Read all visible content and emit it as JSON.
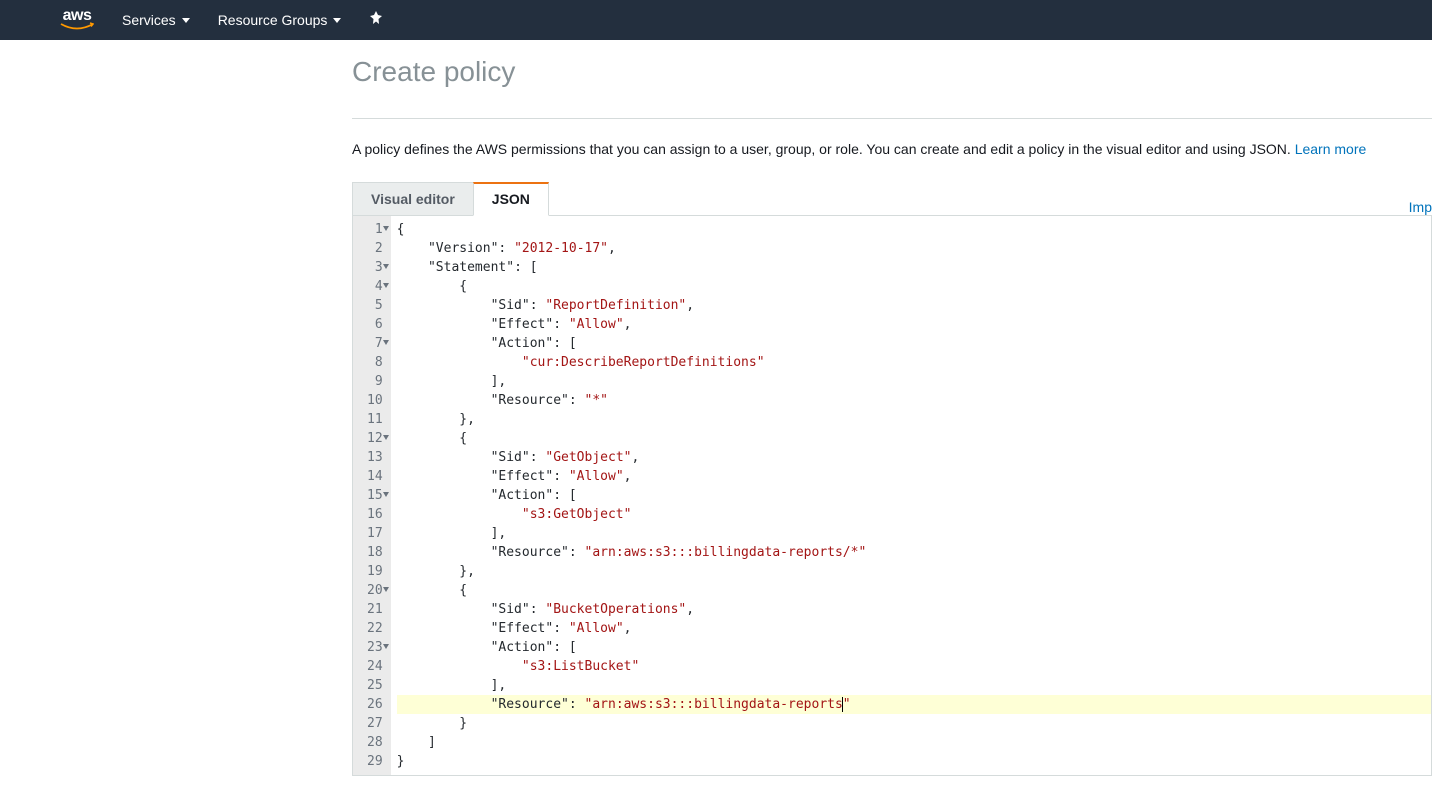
{
  "nav": {
    "logo_text": "aws",
    "services": "Services",
    "resource_groups": "Resource Groups"
  },
  "page": {
    "title": "Create policy",
    "description_prefix": "A policy defines the AWS permissions that you can assign to a user, group, or role. You can create and edit a policy in the visual editor and using JSON. ",
    "learn_more": "Learn more",
    "import_link": "Imp"
  },
  "tabs": {
    "visual": "Visual editor",
    "json": "JSON"
  },
  "editor": {
    "line_count": 29,
    "fold_lines": [
      1,
      3,
      4,
      7,
      12,
      15,
      20,
      23
    ],
    "highlighted_line": 26,
    "code_tokens": [
      [
        {
          "t": "{",
          "c": ""
        }
      ],
      [
        {
          "t": "    ",
          "c": ""
        },
        {
          "t": "\"Version\"",
          "c": "key"
        },
        {
          "t": ": ",
          "c": ""
        },
        {
          "t": "\"2012-10-17\"",
          "c": "str"
        },
        {
          "t": ",",
          "c": ""
        }
      ],
      [
        {
          "t": "    ",
          "c": ""
        },
        {
          "t": "\"Statement\"",
          "c": "key"
        },
        {
          "t": ": [",
          "c": ""
        }
      ],
      [
        {
          "t": "        {",
          "c": ""
        }
      ],
      [
        {
          "t": "            ",
          "c": ""
        },
        {
          "t": "\"Sid\"",
          "c": "key"
        },
        {
          "t": ": ",
          "c": ""
        },
        {
          "t": "\"ReportDefinition\"",
          "c": "str"
        },
        {
          "t": ",",
          "c": ""
        }
      ],
      [
        {
          "t": "            ",
          "c": ""
        },
        {
          "t": "\"Effect\"",
          "c": "key"
        },
        {
          "t": ": ",
          "c": ""
        },
        {
          "t": "\"Allow\"",
          "c": "str"
        },
        {
          "t": ",",
          "c": ""
        }
      ],
      [
        {
          "t": "            ",
          "c": ""
        },
        {
          "t": "\"Action\"",
          "c": "key"
        },
        {
          "t": ": [",
          "c": ""
        }
      ],
      [
        {
          "t": "                ",
          "c": ""
        },
        {
          "t": "\"cur:DescribeReportDefinitions\"",
          "c": "str"
        }
      ],
      [
        {
          "t": "            ],",
          "c": ""
        }
      ],
      [
        {
          "t": "            ",
          "c": ""
        },
        {
          "t": "\"Resource\"",
          "c": "key"
        },
        {
          "t": ": ",
          "c": ""
        },
        {
          "t": "\"*\"",
          "c": "str"
        }
      ],
      [
        {
          "t": "        },",
          "c": ""
        }
      ],
      [
        {
          "t": "        {",
          "c": ""
        }
      ],
      [
        {
          "t": "            ",
          "c": ""
        },
        {
          "t": "\"Sid\"",
          "c": "key"
        },
        {
          "t": ": ",
          "c": ""
        },
        {
          "t": "\"GetObject\"",
          "c": "str"
        },
        {
          "t": ",",
          "c": ""
        }
      ],
      [
        {
          "t": "            ",
          "c": ""
        },
        {
          "t": "\"Effect\"",
          "c": "key"
        },
        {
          "t": ": ",
          "c": ""
        },
        {
          "t": "\"Allow\"",
          "c": "str"
        },
        {
          "t": ",",
          "c": ""
        }
      ],
      [
        {
          "t": "            ",
          "c": ""
        },
        {
          "t": "\"Action\"",
          "c": "key"
        },
        {
          "t": ": [",
          "c": ""
        }
      ],
      [
        {
          "t": "                ",
          "c": ""
        },
        {
          "t": "\"s3:GetObject\"",
          "c": "str"
        }
      ],
      [
        {
          "t": "            ],",
          "c": ""
        }
      ],
      [
        {
          "t": "            ",
          "c": ""
        },
        {
          "t": "\"Resource\"",
          "c": "key"
        },
        {
          "t": ": ",
          "c": ""
        },
        {
          "t": "\"arn:aws:s3:::billingdata-reports/*\"",
          "c": "str"
        }
      ],
      [
        {
          "t": "        },",
          "c": ""
        }
      ],
      [
        {
          "t": "        {",
          "c": ""
        }
      ],
      [
        {
          "t": "            ",
          "c": ""
        },
        {
          "t": "\"Sid\"",
          "c": "key"
        },
        {
          "t": ": ",
          "c": ""
        },
        {
          "t": "\"BucketOperations\"",
          "c": "str"
        },
        {
          "t": ",",
          "c": ""
        }
      ],
      [
        {
          "t": "            ",
          "c": ""
        },
        {
          "t": "\"Effect\"",
          "c": "key"
        },
        {
          "t": ": ",
          "c": ""
        },
        {
          "t": "\"Allow\"",
          "c": "str"
        },
        {
          "t": ",",
          "c": ""
        }
      ],
      [
        {
          "t": "            ",
          "c": ""
        },
        {
          "t": "\"Action\"",
          "c": "key"
        },
        {
          "t": ": [",
          "c": ""
        }
      ],
      [
        {
          "t": "                ",
          "c": ""
        },
        {
          "t": "\"s3:ListBucket\"",
          "c": "str"
        }
      ],
      [
        {
          "t": "            ],",
          "c": ""
        }
      ],
      [
        {
          "t": "            ",
          "c": ""
        },
        {
          "t": "\"Resource\"",
          "c": "key"
        },
        {
          "t": ": ",
          "c": ""
        },
        {
          "t": "\"arn:aws:s3:::billingdata-reports",
          "c": "str"
        },
        {
          "t": "",
          "c": "cursor"
        },
        {
          "t": "\"",
          "c": "str"
        }
      ],
      [
        {
          "t": "        }",
          "c": ""
        }
      ],
      [
        {
          "t": "    ]",
          "c": ""
        }
      ],
      [
        {
          "t": "}",
          "c": ""
        }
      ]
    ]
  }
}
